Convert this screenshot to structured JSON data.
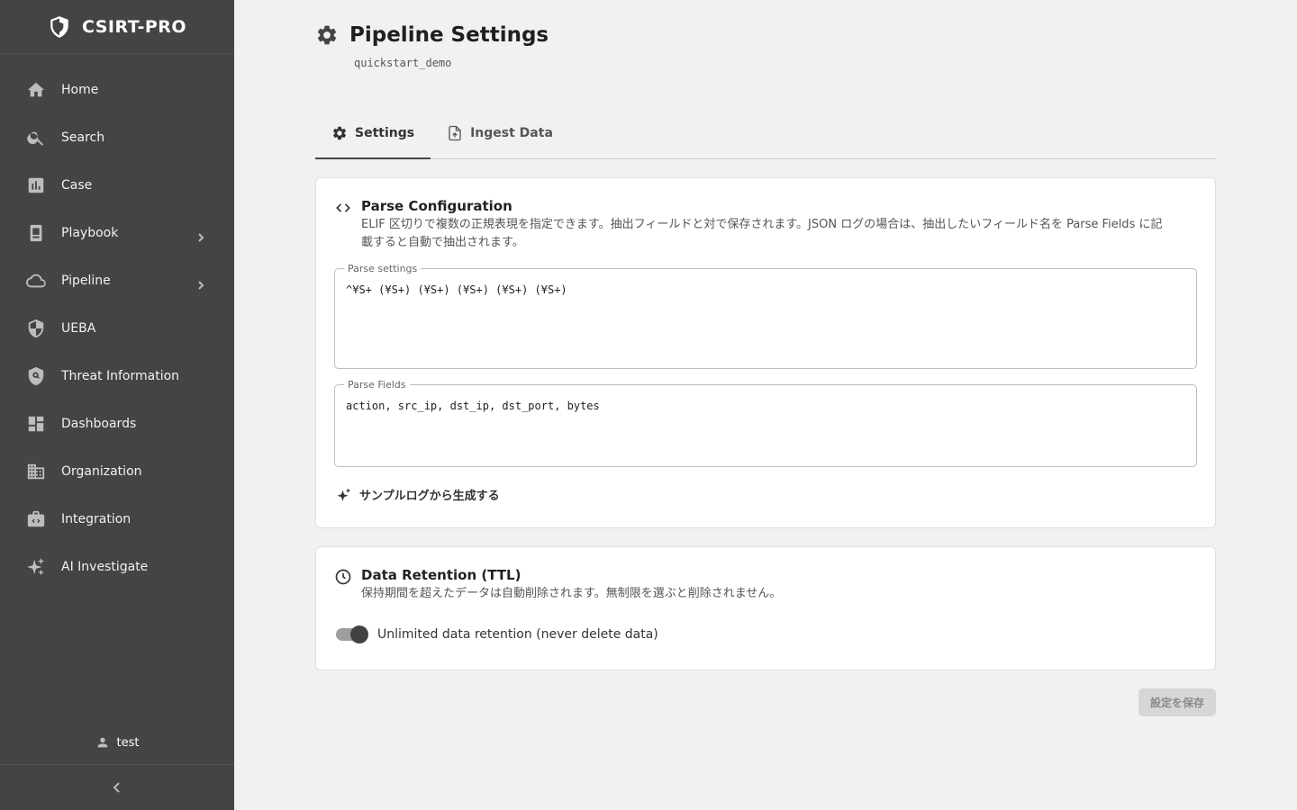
{
  "brand": {
    "name": "CSIRT-PRO"
  },
  "sidebar": {
    "items": [
      {
        "label": "Home",
        "icon": "home-icon",
        "has_children": false
      },
      {
        "label": "Search",
        "icon": "search-icon",
        "has_children": false
      },
      {
        "label": "Case",
        "icon": "chart-icon",
        "has_children": false
      },
      {
        "label": "Playbook",
        "icon": "book-icon",
        "has_children": true
      },
      {
        "label": "Pipeline",
        "icon": "cloud-icon",
        "has_children": true
      },
      {
        "label": "UEBA",
        "icon": "shield-icon",
        "has_children": false
      },
      {
        "label": "Threat Information",
        "icon": "shield-search-icon",
        "has_children": false
      },
      {
        "label": "Dashboards",
        "icon": "dashboard-icon",
        "has_children": false
      },
      {
        "label": "Organization",
        "icon": "building-icon",
        "has_children": false
      },
      {
        "label": "Integration",
        "icon": "integration-icon",
        "has_children": false
      },
      {
        "label": "AI Investigate",
        "icon": "sparkle-icon",
        "has_children": false
      }
    ],
    "user": "test"
  },
  "header": {
    "title": "Pipeline Settings",
    "subtitle": "quickstart_demo"
  },
  "tabs": [
    {
      "label": "Settings",
      "active": true
    },
    {
      "label": "Ingest Data",
      "active": false
    }
  ],
  "parse_config": {
    "title": "Parse Configuration",
    "description": "ELIF 区切りで複数の正規表現を指定できます。抽出フィールドと対で保存されます。JSON ログの場合は、抽出したいフィールド名を Parse Fields に記載すると自動で抽出されます。",
    "settings_label": "Parse settings",
    "settings_value": "^¥S+ (¥S+) (¥S+) (¥S+) (¥S+) (¥S+)",
    "fields_label": "Parse Fields",
    "fields_value": "action, src_ip, dst_ip, dst_port, bytes",
    "generate_label": "サンプルログから生成する"
  },
  "retention": {
    "title": "Data Retention (TTL)",
    "description": "保持期間を超えたデータは自動削除されます。無制限を選ぶと削除されません。",
    "toggle_label": "Unlimited data retention (never delete data)",
    "toggle_on": true
  },
  "save_label": "設定を保存"
}
